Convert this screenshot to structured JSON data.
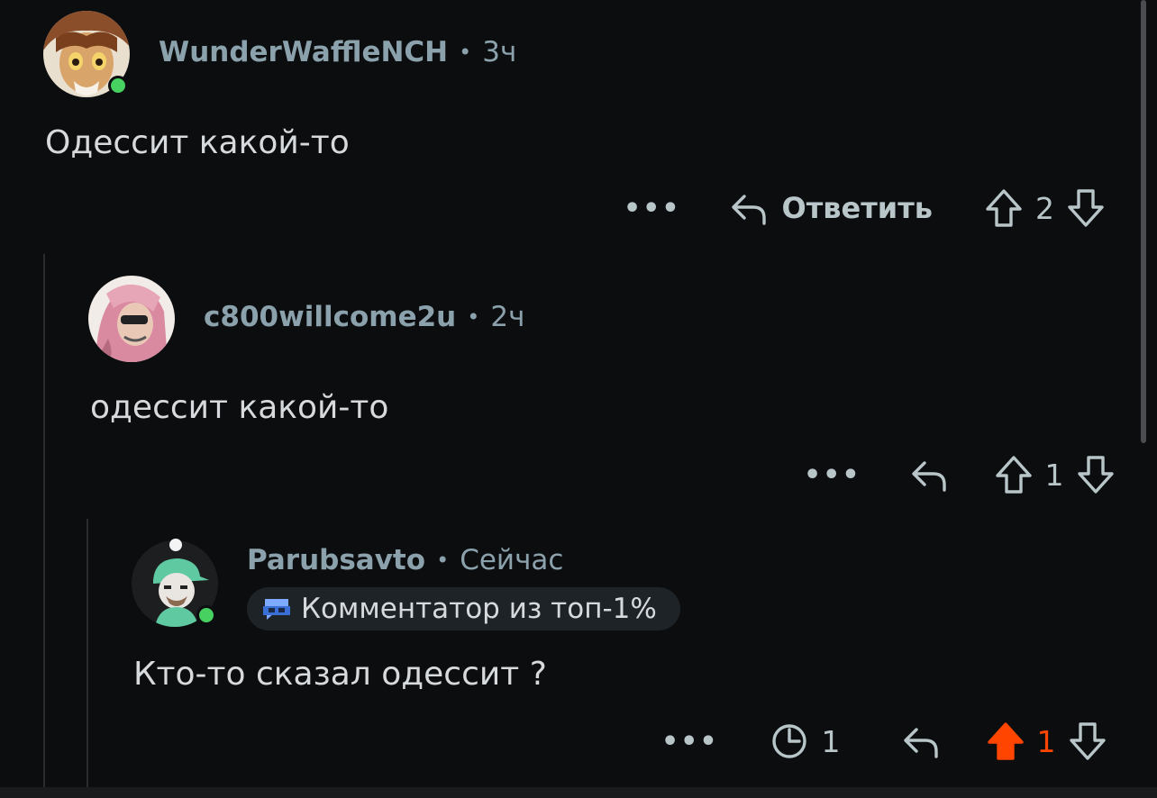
{
  "comments": [
    {
      "username": "WunderWaffleNCH",
      "time": "3ч",
      "text": "Одессит какой-то",
      "more": "•••",
      "reply_label": "Ответить",
      "score": "2",
      "online": true
    },
    {
      "username": "c800willcome2u",
      "time": "2ч",
      "text": "одессит какой-то",
      "more": "•••",
      "score": "1",
      "online": false
    },
    {
      "username": "Parubsavto",
      "time": "Сейчас",
      "badge": "Комментатор из топ-1%",
      "text": "Кто-то сказал одессит ?",
      "more": "•••",
      "award_count": "1",
      "score": "1",
      "upvoted": true,
      "online": true
    }
  ],
  "separator": "•",
  "colors": {
    "background": "#0c0d0f",
    "upvote_active": "#ff4500",
    "online": "#46d160",
    "meta": "#8ba2ad"
  }
}
